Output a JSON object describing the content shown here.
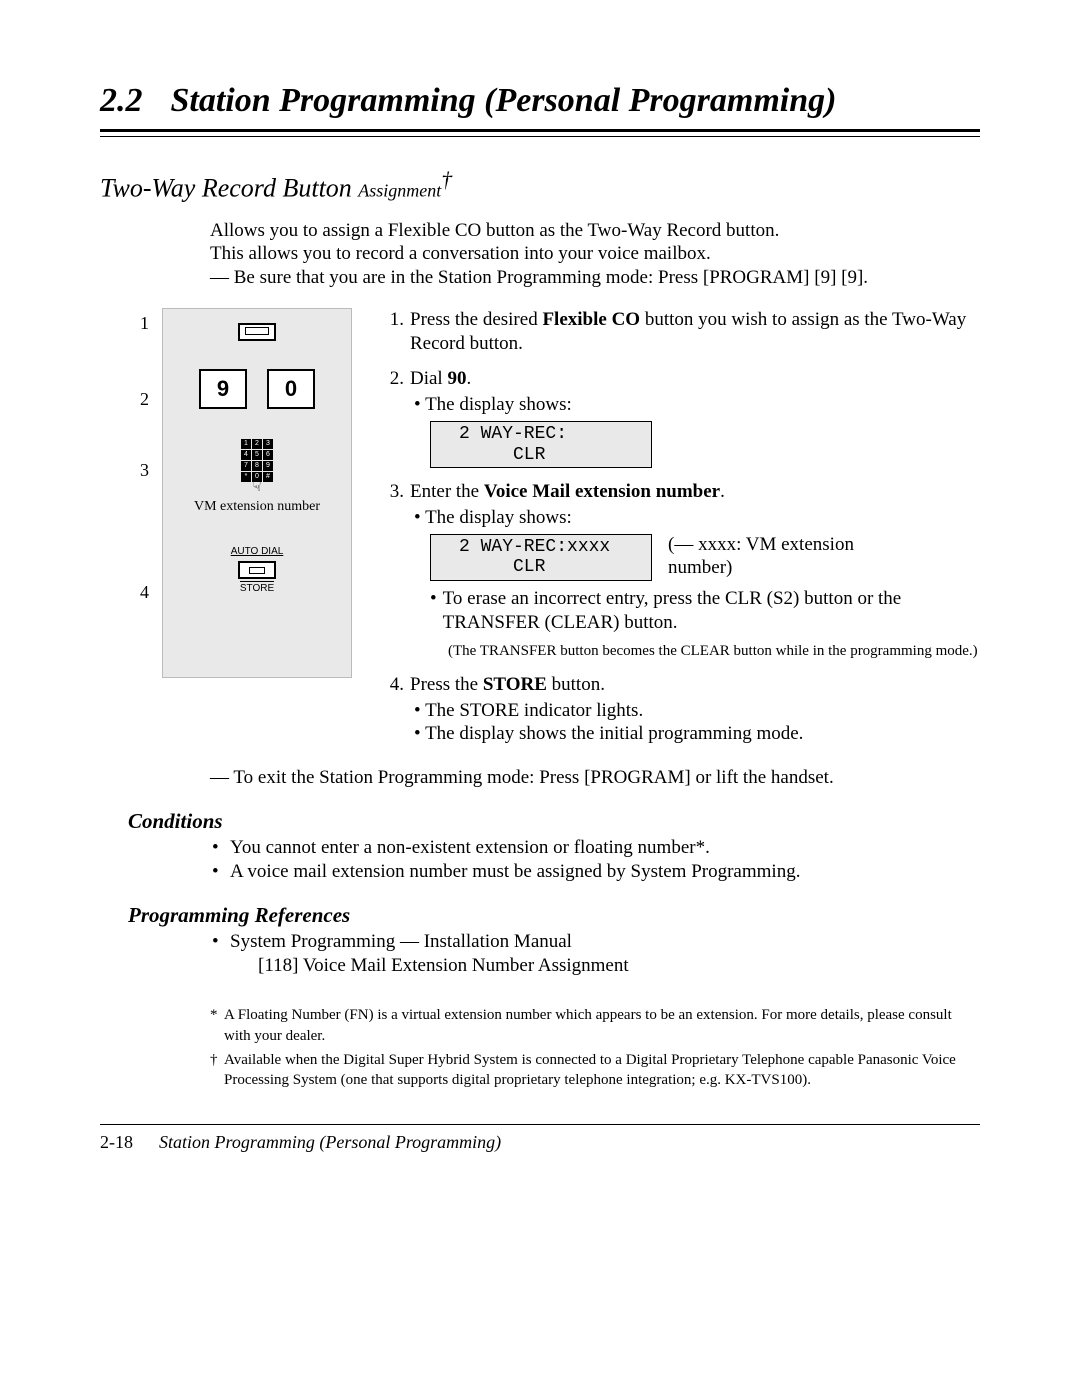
{
  "header": {
    "num": "2.2",
    "title": "Station Programming (Personal Programming)"
  },
  "subtitle": {
    "main": "Two-Way Record Button ",
    "sub": "Assignment",
    "dagger": "†"
  },
  "intro": {
    "l1": "Allows you to assign a Flexible CO button as the Two-Way Record button.",
    "l2": "This allows you to record a conversation into your voice mailbox.",
    "l3": "— Be sure that you are in the Station Programming mode: Press [PROGRAM] [9] [9]."
  },
  "diagram": {
    "n1": "1",
    "n2": "2",
    "n3": "3",
    "n4": "4",
    "k9": "9",
    "k0": "0",
    "vm_label": "VM extension number",
    "auto_dial": "AUTO DIAL",
    "store": "STORE"
  },
  "steps": {
    "s1": {
      "idx": "1.",
      "pre": "Press the desired ",
      "bold": "Flexible CO",
      "post": " button you wish to assign as the Two-Way Record button."
    },
    "s2": {
      "idx": "2.",
      "pre": "Dial ",
      "bold": "90",
      "post": ".",
      "bullet": "The display shows:",
      "display": "2 WAY-REC:\n     CLR"
    },
    "s3": {
      "idx": "3.",
      "pre": "Enter the ",
      "bold": "Voice Mail extension number",
      "post": ".",
      "bullet": "The display shows:",
      "display": "2 WAY-REC:xxxx\n     CLR",
      "annot": "(— xxxx: VM extension number)",
      "erase": "To erase an incorrect entry, press the CLR (S2) button or the TRANSFER (CLEAR) button.",
      "note": "(The TRANSFER button becomes the CLEAR button while in the programming mode.)"
    },
    "s4": {
      "idx": "4.",
      "pre": "Press the ",
      "bold": "STORE",
      "post": " button.",
      "b1": "The STORE indicator lights.",
      "b2": "The display shows the initial programming mode."
    }
  },
  "exit": "— To exit the Station Programming mode: Press [PROGRAM] or lift the handset.",
  "conditions": {
    "hdr": "Conditions",
    "c1": "You cannot enter a non-existent extension or floating number*.",
    "c2": "A voice mail extension number must be assigned by System Programming."
  },
  "refs": {
    "hdr": "Programming References",
    "r1": "System Programming — Installation Manual",
    "r1sub": "[118]  Voice Mail Extension Number Assignment"
  },
  "footnotes": {
    "star_sym": "*",
    "star": "A Floating Number (FN) is a virtual extension number which appears to be an extension. For more details, please consult with your dealer.",
    "dag_sym": "†",
    "dag": "Available when the Digital Super Hybrid System is connected to a Digital Proprietary Telephone capable Panasonic Voice Processing System (one that supports digital proprietary telephone integration; e.g. KX-TVS100)."
  },
  "footer": {
    "page": "2-18",
    "title": "Station Programming (Personal Programming)"
  }
}
